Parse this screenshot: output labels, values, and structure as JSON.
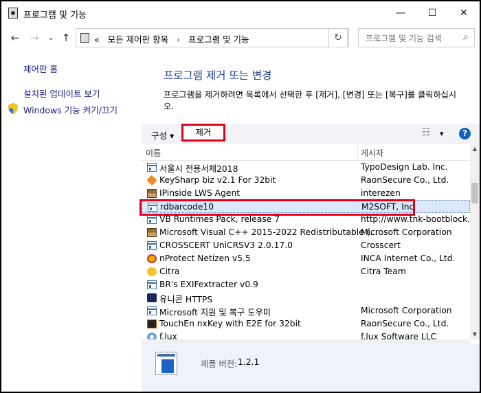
{
  "window": {
    "title": "프로그램 및 기능",
    "minimize": "—",
    "maximize": "☐",
    "close": "✕"
  },
  "nav": {
    "back": "←",
    "forward": "→",
    "down": "⌄",
    "up": "↑",
    "breadcrumbs": [
      "«",
      "모든 제어판 항목",
      "›",
      "프로그램 및 기능"
    ],
    "search_placeholder": "프로그램 및 기능 검색"
  },
  "sidebar": {
    "items": [
      {
        "label": "제어판 홈"
      },
      {
        "label": "설치된 업데이트 보기"
      },
      {
        "label": "Windows 기능 켜기/끄기"
      }
    ]
  },
  "main": {
    "heading": "프로그램 제거 또는 변경",
    "description": "프로그램을 제거하려면 목록에서 선택한 후 [제거], [변경] 또는 [복구]를 클릭하십시오."
  },
  "toolbar": {
    "organize": "구성 ▾",
    "uninstall": "제거",
    "view": "☷",
    "view_drop": "▾",
    "help": "?"
  },
  "table": {
    "columns": [
      "이름",
      "게시자"
    ],
    "rows": [
      {
        "name": "서울시 전용서체2018",
        "publisher": "TypoDesign Lab. Inc.",
        "icon": "window-icon"
      },
      {
        "name": "KeySharp biz v2.1 For 32bit",
        "publisher": "RaonSecure Co., Ltd.",
        "icon": "key-icon"
      },
      {
        "name": "IPinside LWS Agent",
        "publisher": "interezen",
        "icon": "installer-icon"
      },
      {
        "name": "rdbarcode10",
        "publisher": "M2SOFT, Inc",
        "icon": "window-icon",
        "selected": true
      },
      {
        "name": "VB Runtimes Pack, release 7",
        "publisher": "http://www.tnk-bootblock.co",
        "icon": "window-icon"
      },
      {
        "name": "Microsoft Visual C++ 2015-2022 Redistributable (...",
        "publisher": "Microsoft Corporation",
        "icon": "installer-icon"
      },
      {
        "name": "CROSSCERT UniCRSV3 2.0.17.0",
        "publisher": "Crosscert",
        "icon": "window-icon"
      },
      {
        "name": "nProtect Netizen v5.5",
        "publisher": "INCA Internet Co., Ltd.",
        "icon": "nprotect-icon"
      },
      {
        "name": "Citra",
        "publisher": "Citra Team",
        "icon": "citra-icon"
      },
      {
        "name": "BR's EXIFextracter v0.9",
        "publisher": "",
        "icon": "window-icon"
      },
      {
        "name": "유니콘 HTTPS",
        "publisher": "",
        "icon": "unicorn-icon"
      },
      {
        "name": "Microsoft 지원 및 복구 도우미",
        "publisher": "Microsoft Corporation",
        "icon": "window-icon"
      },
      {
        "name": "TouchEn nxKey with E2E for 32bit",
        "publisher": "RaonSecure Co., Ltd.",
        "icon": "nxkey-icon"
      },
      {
        "name": "f.lux",
        "publisher": "f.lux Software LLC",
        "icon": "flux-icon"
      }
    ]
  },
  "details": {
    "label": "제품 버전:",
    "value": "1.2.1"
  },
  "colors": {
    "heading": "#1e3d8f",
    "link": "#1a1a8a",
    "highlight": "#e0001b",
    "selected_bg": "#d9e8fa"
  }
}
